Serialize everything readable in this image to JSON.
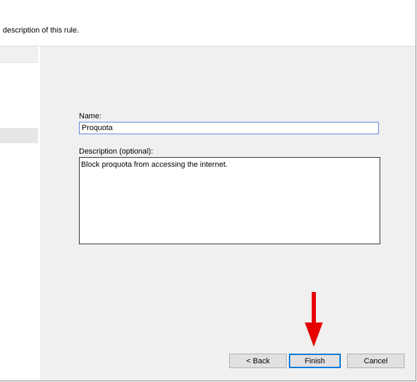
{
  "header": {
    "text": "description of this rule."
  },
  "form": {
    "name_label": "Name:",
    "name_value": "Proquota",
    "description_label": "Description (optional):",
    "description_value": "Block proquota from accessing the internet."
  },
  "buttons": {
    "back": "< Back",
    "finish": "Finish",
    "cancel": "Cancel"
  },
  "annotation": {
    "arrow_color": "#e60000",
    "arrow_icon": "red-arrow-down-icon"
  }
}
